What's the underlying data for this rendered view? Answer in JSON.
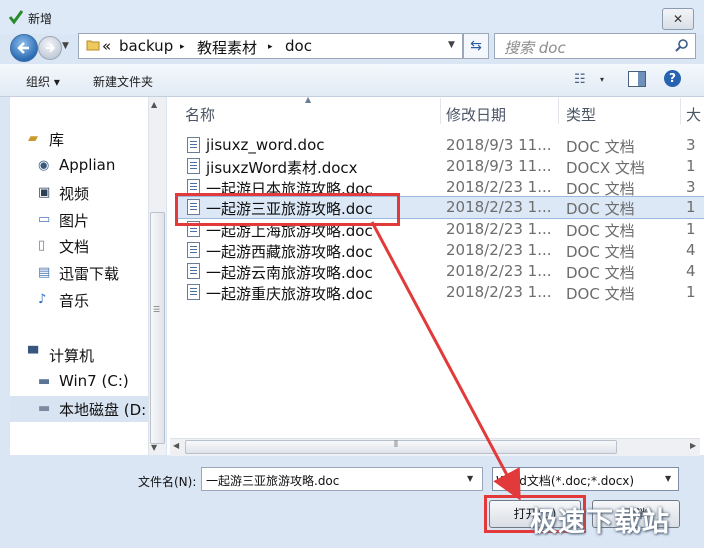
{
  "window": {
    "title": "新增",
    "close_glyph": "✕"
  },
  "address": {
    "prefix": "«",
    "crumbs": [
      "backup",
      "教程素材",
      "doc"
    ],
    "separator": "▸"
  },
  "search": {
    "placeholder": "搜索 doc"
  },
  "toolbar": {
    "organize": "组织 ▾",
    "new_folder": "新建文件夹",
    "view_glyph": "☷",
    "view_dd": "▾",
    "help": "?"
  },
  "sidebar": {
    "items": [
      {
        "label": "库",
        "icon": "library-icon"
      },
      {
        "label": "Applian",
        "icon": "owl-icon"
      },
      {
        "label": "视频",
        "icon": "video-icon"
      },
      {
        "label": "图片",
        "icon": "picture-icon"
      },
      {
        "label": "文档",
        "icon": "document-icon"
      },
      {
        "label": "迅雷下载",
        "icon": "download-icon"
      },
      {
        "label": "音乐",
        "icon": "music-icon"
      },
      {
        "label": "计算机",
        "icon": "computer-icon"
      },
      {
        "label": "Win7 (C:)",
        "icon": "drive-icon"
      },
      {
        "label": "本地磁盘 (D:",
        "icon": "drive-icon",
        "selected": true
      }
    ]
  },
  "columns": {
    "name": "名称",
    "date": "修改日期",
    "type": "类型",
    "size": "大"
  },
  "files": [
    {
      "name": "jisuxz_word.doc",
      "date": "2018/9/3 11...",
      "type": "DOC 文档",
      "size": "3"
    },
    {
      "name": "jisuxzWord素材.docx",
      "date": "2018/9/3 11...",
      "type": "DOCX 文档",
      "size": "1"
    },
    {
      "name": "一起游日本旅游攻略.doc",
      "date": "2018/2/23 1...",
      "type": "DOC 文档",
      "size": "3"
    },
    {
      "name": "一起游三亚旅游攻略.doc",
      "date": "2018/2/23 1...",
      "type": "DOC 文档",
      "size": "1",
      "selected": true
    },
    {
      "name": "一起游上海旅游攻略.doc",
      "date": "2018/2/23 1...",
      "type": "DOC 文档",
      "size": "1"
    },
    {
      "name": "一起游西藏旅游攻略.doc",
      "date": "2018/2/23 1...",
      "type": "DOC 文档",
      "size": "4"
    },
    {
      "name": "一起游云南旅游攻略.doc",
      "date": "2018/2/23 1...",
      "type": "DOC 文档",
      "size": "4"
    },
    {
      "name": "一起游重庆旅游攻略.doc",
      "date": "2018/2/23 1...",
      "type": "DOC 文档",
      "size": "1"
    }
  ],
  "footer": {
    "filename_label": "文件名(N):",
    "filename_value": "一起游三亚旅游攻略.doc",
    "filetype_value": "Word文档(*.doc;*.docx)",
    "open_label": "打开(O)",
    "cancel_label": "取消"
  },
  "watermark": "极速下载站",
  "colors": {
    "annotation": "#e23a3a",
    "selection": "#dce8f6",
    "chrome": "#dbe6f4"
  }
}
